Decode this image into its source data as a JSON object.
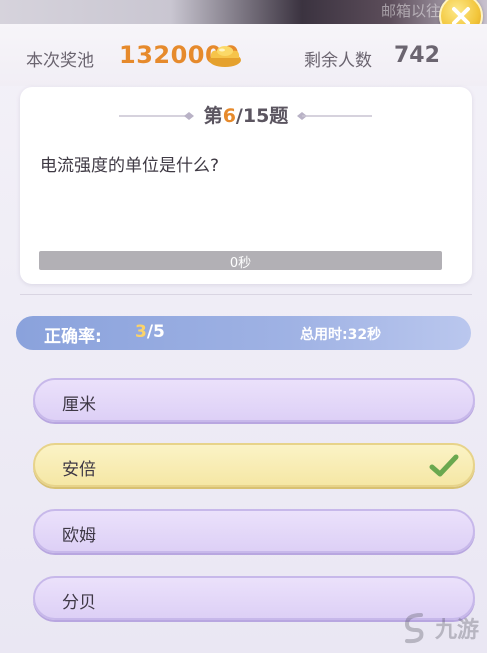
{
  "header": {
    "faded_text": "邮箱以往",
    "prize_pool_label": "本次奖池",
    "prize_pool_value": "1320000",
    "remaining_label": "剩余人数",
    "remaining_value": "742"
  },
  "question": {
    "prefix": "第",
    "current": "6",
    "total_text": "/15题",
    "text": "电流强度的单位是什么?",
    "timer_text": "0秒"
  },
  "score": {
    "accuracy_label": "正确率:",
    "correct": "3",
    "total_text": "/5",
    "time_used_label": "总用时:32秒"
  },
  "options": [
    {
      "label": "厘米",
      "state": "normal"
    },
    {
      "label": "安倍",
      "state": "correct"
    },
    {
      "label": "欧姆",
      "state": "normal"
    },
    {
      "label": "分贝",
      "state": "normal"
    }
  ],
  "watermark": {
    "text": "九游"
  },
  "colors": {
    "accent_orange": "#e68a2c",
    "option_purple": "#ddd0f6",
    "option_correct": "#f5e7a5",
    "check_green": "#6aa84f",
    "score_bar_blue": "#9fb2e4"
  },
  "icons": {
    "close": "close-icon",
    "ingot": "gold-ingot-icon",
    "check": "check-icon",
    "logo": "jiuyou-logo-icon"
  }
}
